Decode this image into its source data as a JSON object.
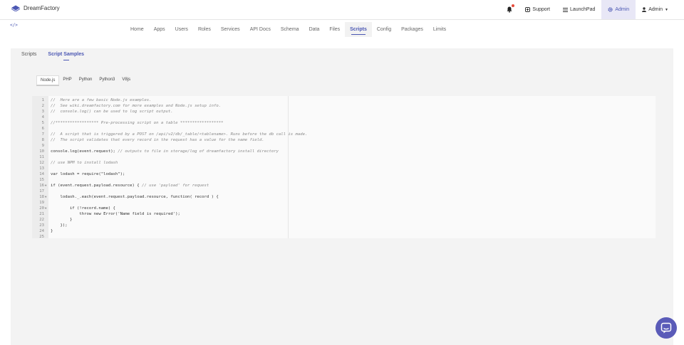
{
  "brand": {
    "name": "DreamFactory"
  },
  "topnav": {
    "notifications_icon": "bell-icon",
    "support": "Support",
    "launchpad": "LaunchPad",
    "admin_active": "Admin",
    "admin_user": "Admin"
  },
  "mainnav": {
    "items": [
      "Home",
      "Apps",
      "Users",
      "Roles",
      "Services",
      "API Docs",
      "Schema",
      "Data",
      "Files",
      "Scripts",
      "Config",
      "Packages",
      "Limits"
    ],
    "active": "Scripts"
  },
  "subtabs": {
    "items": [
      "Scripts",
      "Script Samples"
    ],
    "active": "Script Samples"
  },
  "langtabs": {
    "items": [
      "Node.js",
      "PHP",
      "Python",
      "Python3",
      "V8js"
    ],
    "active": "Node.js"
  },
  "code": {
    "lines": [
      "//  Here are a few basic Node.js examples.",
      "//  See wiki.dreamfactory.com for more examples and Node.js setup info.",
      "//  console.log() can be used to log script output.",
      "",
      "//****************** Pre-processing script on a table ******************",
      "",
      "//  A script that is triggered by a POST on /api/v2/db/_table/<tablename>. Runs before the db call is made.",
      "//  The script validates that every record in the request has a value for the name field.",
      "",
      "console.log(event.request); // outputs to file in storage/log of dreamfactory install directory",
      "",
      "// use NPM to install lodash",
      "",
      "var lodash = require(\"lodash\");",
      "",
      "if (event.request.payload.resource) { // use 'payload' for request",
      "",
      "    lodash._.each(event.request.payload.resource, function( record ) {",
      "",
      "        if (!record.name) {",
      "            throw new Error('Name field is required');",
      "        }",
      "    });",
      "}",
      ""
    ],
    "fold_lines": [
      16,
      18,
      20
    ]
  },
  "colors": {
    "accent": "#4b57b3",
    "chat_button": "#5a5bb8",
    "notification_dot": "#e74c3c"
  },
  "chat_icon": "chat-bubble-icon"
}
